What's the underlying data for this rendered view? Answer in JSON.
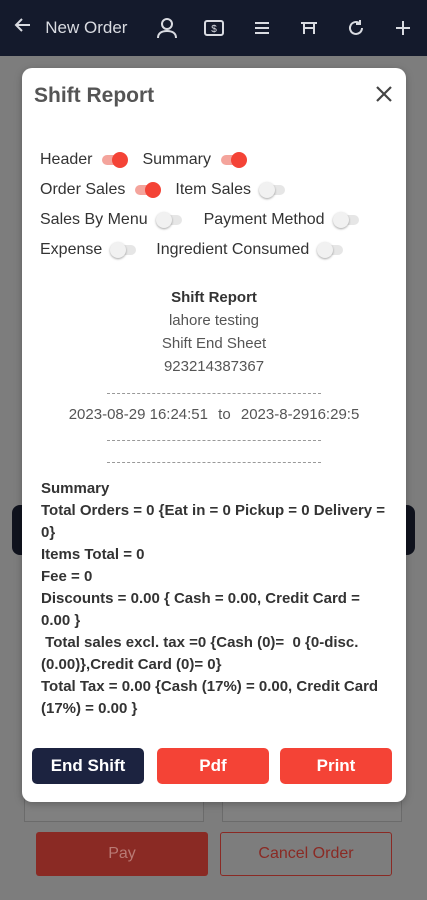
{
  "topbar": {
    "back_icon": "arrow-left-icon",
    "title": "New Order",
    "icons": [
      "user-icon",
      "cash-register-icon",
      "menu-icon",
      "table-icon",
      "refresh-icon",
      "plus-icon"
    ]
  },
  "background": {
    "pay_label": "Pay",
    "cancel_label": "Cancel Order"
  },
  "modal": {
    "title": "Shift Report",
    "close_icon": "close-icon",
    "options": {
      "header": {
        "label": "Header",
        "on": true
      },
      "summary": {
        "label": "Summary",
        "on": true
      },
      "order_sales": {
        "label": "Order Sales",
        "on": true
      },
      "item_sales": {
        "label": "Item Sales",
        "on": false
      },
      "sales_by_menu": {
        "label": "Sales By Menu",
        "on": false
      },
      "payment_method": {
        "label": "Payment Method",
        "on": false
      },
      "expense": {
        "label": "Expense",
        "on": false
      },
      "ingredient_consumed": {
        "label": "Ingredient Consumed",
        "on": false
      }
    },
    "report": {
      "title": "Shift Report",
      "store": "lahore testing",
      "subtitle": "Shift End Sheet",
      "phone": "923214387367",
      "start": "2023-08-29 16:24:51",
      "to": "to",
      "end": "2023-8-2916:29:5"
    },
    "summary": {
      "heading": "Summary",
      "lines": [
        "Total Orders = 0 {Eat in = 0 Pickup = 0 Delivery = 0}",
        "Items Total = 0",
        "Fee = 0",
        "Discounts = 0.00 { Cash = 0.00, Credit Card = 0.00 }",
        " Total sales excl. tax =0 {Cash (0)=  0 {0-disc.(0.00)},Credit Card (0)= 0}",
        "Total Tax = 0.00 {Cash (17%) = 0.00, Credit Card (17%) = 0.00 }"
      ]
    },
    "buttons": {
      "end_shift": "End Shift",
      "pdf": "Pdf",
      "print": "Print"
    }
  },
  "colors": {
    "accent": "#f44336",
    "navy": "#1c2340"
  }
}
